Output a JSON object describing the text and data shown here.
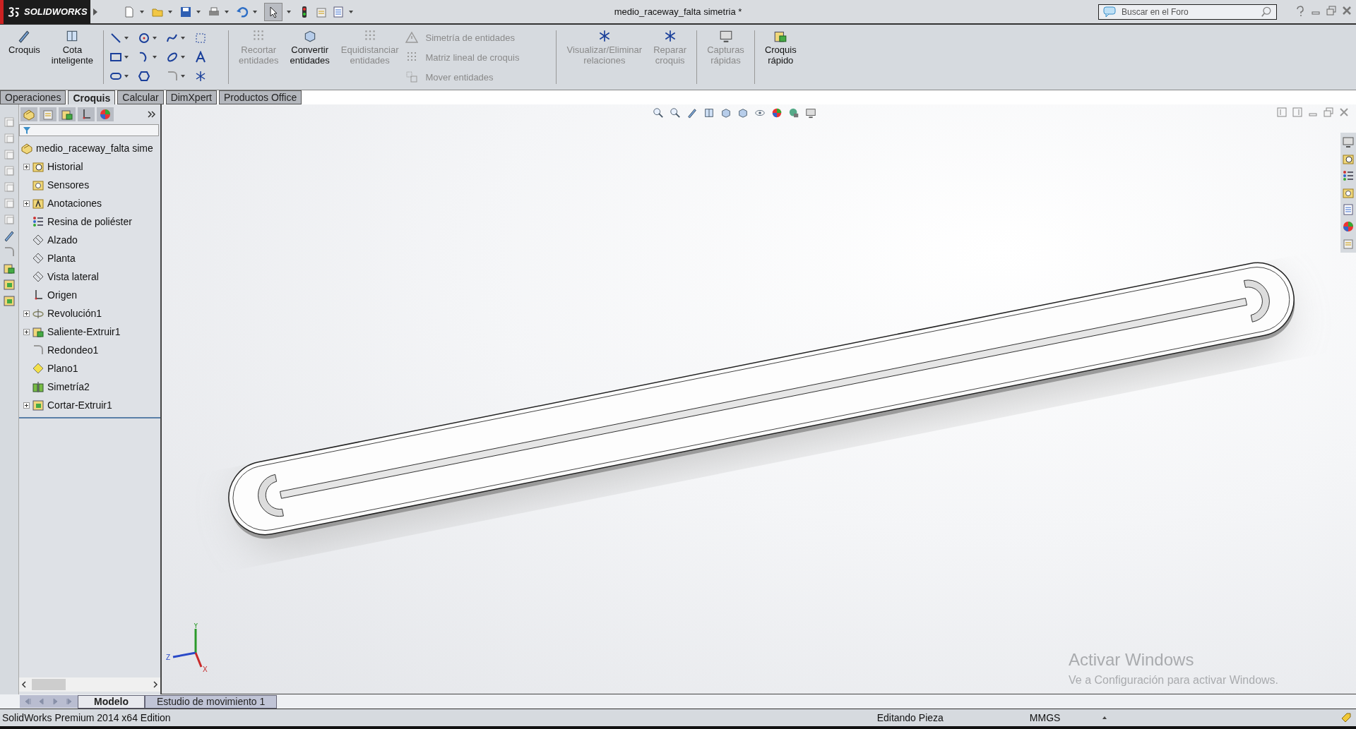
{
  "title_bar": {
    "logo": "SOLIDWORKS",
    "title": "medio_raceway_falta simetria *",
    "search": {
      "placeholder": "Buscar en el Foro"
    }
  },
  "ribbon": {
    "big_buttons": [
      {
        "label": "Croquis",
        "disabled": false
      },
      {
        "label": "Cota inteligente",
        "disabled": false
      }
    ],
    "edit_buttons": [
      {
        "label": "Recortar entidades",
        "disabled": true
      },
      {
        "label": "Convertir entidades",
        "disabled": false
      },
      {
        "label": "Equidistanciar entidades",
        "disabled": true
      }
    ],
    "small_items": [
      {
        "label": "Simetría de entidades",
        "disabled": true
      },
      {
        "label": "Matriz lineal de croquis",
        "disabled": true
      },
      {
        "label": "Mover entidades",
        "disabled": true
      }
    ],
    "right_buttons": [
      {
        "label": "Visualizar/Eliminar relaciones",
        "disabled": true
      },
      {
        "label": "Reparar croquis",
        "disabled": true
      },
      {
        "label": "Capturas rápidas",
        "disabled": true
      },
      {
        "label": "Croquis rápido",
        "disabled": false
      }
    ]
  },
  "tabs": [
    {
      "label": "Operaciones",
      "selected": false
    },
    {
      "label": "Croquis",
      "selected": true
    },
    {
      "label": "Calcular",
      "selected": false
    },
    {
      "label": "DimXpert",
      "selected": false
    },
    {
      "label": "Productos Office",
      "selected": false
    }
  ],
  "feature_tree": {
    "root": "medio_raceway_falta sime",
    "items": [
      {
        "label": "Historial",
        "expandable": true
      },
      {
        "label": "Sensores",
        "expandable": false
      },
      {
        "label": "Anotaciones",
        "expandable": true
      },
      {
        "label": "Resina de poliéster",
        "expandable": false
      },
      {
        "label": "Alzado",
        "expandable": false
      },
      {
        "label": "Planta",
        "expandable": false
      },
      {
        "label": "Vista lateral",
        "expandable": false
      },
      {
        "label": "Origen",
        "expandable": false
      },
      {
        "label": "Revolución1",
        "expandable": true
      },
      {
        "label": "Saliente-Extruir1",
        "expandable": true
      },
      {
        "label": "Redondeo1",
        "expandable": false
      },
      {
        "label": "Plano1",
        "expandable": false
      },
      {
        "label": "Simetría2",
        "expandable": false
      },
      {
        "label": "Cortar-Extruir1",
        "expandable": true
      }
    ]
  },
  "triad": {
    "y": "Y",
    "z": "Z",
    "x": "X"
  },
  "activation_notice": {
    "title": "Activar Windows",
    "text": "Ve a Configuración para activar Windows."
  },
  "bottom_tabs": [
    {
      "label": "Modelo",
      "selected": true
    },
    {
      "label": "Estudio de movimiento 1",
      "selected": false
    }
  ],
  "status_bar": {
    "edition": "SolidWorks Premium 2014 x64 Edition",
    "mode": "Editando Pieza",
    "units": "MMGS"
  }
}
